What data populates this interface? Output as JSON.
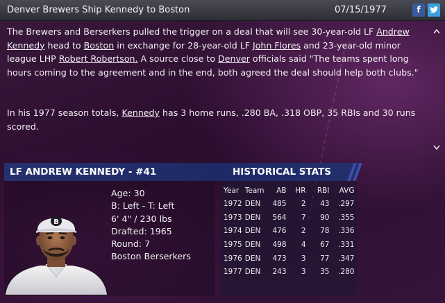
{
  "header": {
    "headline": "Denver Brewers Ship Kennedy to Boston",
    "date": "07/15/1977",
    "facebook_glyph": "f",
    "twitter_glyph": "t"
  },
  "article": {
    "p1_a": "The Brewers and Berserkers pulled the trigger on a deal that will see 30-year-old LF ",
    "p1_link_player": "Andrew Kennedy",
    "p1_b": " head to ",
    "p1_link_team": "Boston",
    "p1_c": " in exchange for 28-year-old LF ",
    "p1_link_flores": "John Flores",
    "p1_d": " and 23-year-old minor league LHP ",
    "p1_link_robertson": "Robert Robertson.",
    "p1_e": " A source close to ",
    "p1_link_denver": "Denver",
    "p1_f": " officials said \"The teams spent long hours coming to the agreement and in the end, both agreed the deal should help both clubs.\"",
    "p2_a": "In his 1977 season totals, ",
    "p2_link": "Kennedy",
    "p2_b": " has 3 home runs, .280 BA, .318 OBP, 35 RBIs and 30 runs scored."
  },
  "scroll": {
    "up": "^",
    "down": "v"
  },
  "player": {
    "title": "LF ANDREW KENNEDY - #41",
    "age": "Age: 30",
    "bats_throws": "B: Left - T: Left",
    "size": "6' 4\" / 230 lbs",
    "drafted": "Drafted: 1965",
    "round": "Round: 7",
    "team": "Boston Berserkers",
    "cap_logo": "B"
  },
  "stats": {
    "title": "HISTORICAL STATS",
    "headers": [
      "Year",
      "Team",
      "AB",
      "HR",
      "RBI",
      "AVG"
    ],
    "rows": [
      [
        "1972",
        "DEN",
        "485",
        "2",
        "43",
        ".297"
      ],
      [
        "1973",
        "DEN",
        "564",
        "7",
        "90",
        ".355"
      ],
      [
        "1974",
        "DEN",
        "476",
        "2",
        "78",
        ".336"
      ],
      [
        "1975",
        "DEN",
        "498",
        "4",
        "67",
        ".331"
      ],
      [
        "1976",
        "DEN",
        "473",
        "3",
        "77",
        ".347"
      ],
      [
        "1977",
        "DEN",
        "243",
        "3",
        "35",
        ".280"
      ]
    ]
  },
  "colors": {
    "background": "#2b0d2e",
    "banner": "#25306e",
    "facebook": "#3a5a9c",
    "twitter": "#3aa0e0"
  },
  "icons": [
    "facebook-icon",
    "twitter-icon",
    "scroll-up-icon",
    "scroll-down-icon"
  ]
}
